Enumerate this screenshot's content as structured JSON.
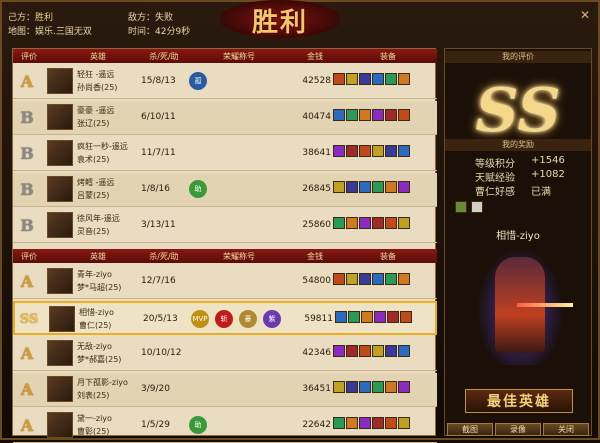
{
  "header": {
    "my_side_label": "己方：",
    "my_side_value": "胜利",
    "enemy_side_label": "敌方：",
    "enemy_side_value": "失败",
    "map_label": "地图：",
    "map_value": "娱乐.三国无双",
    "time_label": "时间：",
    "time_value": "42分9秒",
    "banner": "胜利"
  },
  "columns": [
    "评价",
    "英雄",
    "杀/死/助",
    "荣耀称号",
    "金钱",
    "装备"
  ],
  "team1": [
    {
      "grade": "A",
      "name": "轻狂 -遥远",
      "sub": "孙尚香(25)",
      "kda": "15/8/13",
      "honors": [
        "孤"
      ],
      "gold": "42528"
    },
    {
      "grade": "B",
      "name": "豪豪 -遥远",
      "sub": "张辽(25)",
      "kda": "6/10/11",
      "honors": [],
      "gold": "40474"
    },
    {
      "grade": "B",
      "name": "疯狂一秒-遥远",
      "sub": "袁术(25)",
      "kda": "11/7/11",
      "honors": [],
      "gold": "38641"
    },
    {
      "grade": "B",
      "name": "烤鳕 -遥远",
      "sub": "吕蒙(25)",
      "kda": "1/8/16",
      "honors": [
        "助"
      ],
      "gold": "26845"
    },
    {
      "grade": "B",
      "name": "徐风年-遥远",
      "sub": "灵音(25)",
      "kda": "3/13/11",
      "honors": [],
      "gold": "25860"
    }
  ],
  "team2": [
    {
      "grade": "A",
      "name": "青年-ziyo",
      "sub": "梦*马超(25)",
      "kda": "12/7/16",
      "honors": [],
      "gold": "54800"
    },
    {
      "grade": "SS",
      "name": "相惜-ziyo",
      "sub": "曹仁(25)",
      "kda": "20/5/13",
      "honors": [
        "MVP",
        "斩",
        "豪",
        "紫"
      ],
      "gold": "59811"
    },
    {
      "grade": "A",
      "name": "无敌-ziyo",
      "sub": "梦*郝嘉(25)",
      "kda": "10/10/12",
      "honors": [],
      "gold": "42346"
    },
    {
      "grade": "A",
      "name": "月下孤影-ziyo",
      "sub": "刘表(25)",
      "kda": "3/9/20",
      "honors": [],
      "gold": "36451"
    },
    {
      "grade": "A",
      "name": "黛一-ziyo",
      "sub": "曹彰(25)",
      "kda": "1/5/29",
      "honors": [
        "助"
      ],
      "gold": "22642"
    }
  ],
  "my_eval": {
    "title": "我的评价",
    "grade": "SS"
  },
  "my_reward": {
    "title": "我的奖励",
    "items": [
      {
        "label": "等级积分",
        "value": "+1546"
      },
      {
        "label": "天赋经验",
        "value": "+1082"
      },
      {
        "label": "曹仁好感",
        "value": "已满"
      }
    ]
  },
  "player_name": "相惜-ziyo",
  "best_hero": "最佳英雄",
  "buttons": {
    "capture": "截图",
    "replay": "录像",
    "close": "关闭"
  }
}
